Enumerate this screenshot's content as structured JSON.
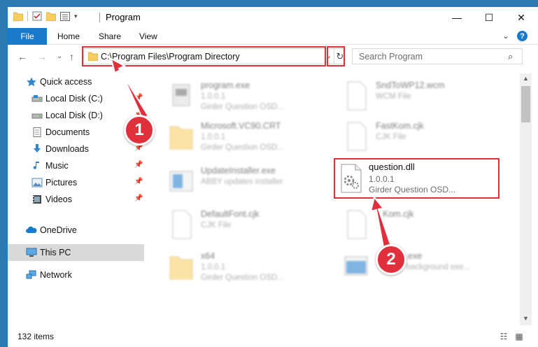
{
  "window": {
    "title": "Program",
    "minimize_glyph": "—",
    "maximize_glyph": "☐",
    "close_glyph": "✕"
  },
  "ribbon": {
    "file_tab": "File",
    "tabs": [
      "Home",
      "Share",
      "View"
    ],
    "expand_glyph": "⌄",
    "help_glyph": "?"
  },
  "nav": {
    "back_glyph": "←",
    "forward_glyph": "→",
    "recent_glyph": "⌄",
    "up_glyph": "↑",
    "address": "C:\\Program Files\\Program Directory",
    "dropdown_glyph": "⌄",
    "refresh_glyph": "↻",
    "search_placeholder": "Search Program",
    "search_glyph": "⌕"
  },
  "sidebar": {
    "items": [
      {
        "label": "Quick access",
        "icon": "star-icon"
      },
      {
        "label": "Local Disk (C:)",
        "icon": "drive-icon",
        "pinned": true
      },
      {
        "label": "Local Disk (D:)",
        "icon": "drive-icon",
        "pinned": true
      },
      {
        "label": "Documents",
        "icon": "documents-icon",
        "pinned": true
      },
      {
        "label": "Downloads",
        "icon": "downloads-icon",
        "pinned": true
      },
      {
        "label": "Music",
        "icon": "music-icon",
        "pinned": true
      },
      {
        "label": "Pictures",
        "icon": "pictures-icon",
        "pinned": true
      },
      {
        "label": "Videos",
        "icon": "videos-icon",
        "pinned": true
      },
      {
        "label": "OneDrive",
        "icon": "onedrive-icon"
      },
      {
        "label": "This PC",
        "icon": "this-pc-icon",
        "selected": true
      },
      {
        "label": "Network",
        "icon": "network-icon"
      }
    ],
    "pin_glyph": "📌"
  },
  "files": [
    {
      "name": "program.exe",
      "version": "1.0.0.1",
      "desc": "Girder Question OSD...",
      "icon": "exe-icon"
    },
    {
      "name": "SndToWP12.wcm",
      "version": "WCM File",
      "desc": "",
      "icon": "blank-file-icon"
    },
    {
      "name": "Microsoft.VC90.CRT",
      "version": "1.0.0.1",
      "desc": "Girder Question OSD...",
      "icon": "folder-icon"
    },
    {
      "name": "FastKom.cjk",
      "version": "CJK File",
      "desc": "",
      "icon": "blank-file-icon"
    },
    {
      "name": "UpdateInstaller.exe",
      "version": "ABBY updates installer",
      "desc": "",
      "icon": "installer-icon"
    },
    {
      "name": "DefaultFont.cjk",
      "version": "CJK File",
      "desc": "",
      "icon": "blank-file-icon"
    },
    {
      "name": "Kom.cjk",
      "version": "",
      "desc": "",
      "icon": "blank-file-icon"
    },
    {
      "name": "x64",
      "version": "1.0.0.1",
      "desc": "Girder Question OSD...",
      "icon": "folder-icon"
    },
    {
      "name": "Bgrec.exe",
      "version": "ABBY background exe...",
      "desc": "",
      "icon": "app-window-icon"
    }
  ],
  "focus_file": {
    "name": "question.dll",
    "version": "1.0.0.1",
    "desc": "Girder Question OSD..."
  },
  "annotations": {
    "step1": "1",
    "step2": "2"
  },
  "status": {
    "item_count": "132 items"
  },
  "colors": {
    "accent": "#1979ca",
    "highlight": "#e0303c"
  }
}
